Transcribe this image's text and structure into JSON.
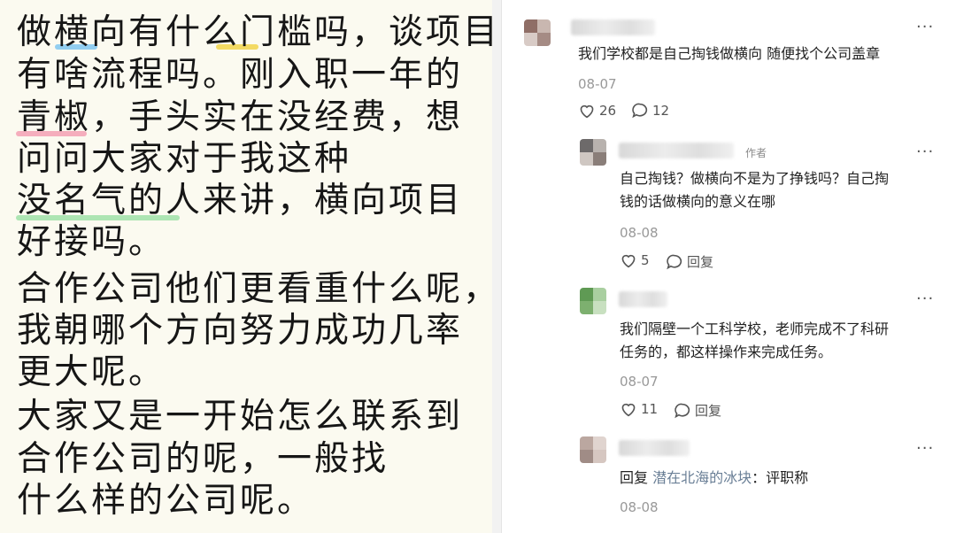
{
  "note": {
    "lines": [
      "做横向有什么门槛吗，谈项目",
      "有啥流程吗。刚入职一年的",
      "青椒，手头实在没经费，想",
      "问问大家对于我这种",
      "没名气的人来讲，横向项目",
      "好接吗。",
      "合作公司他们更看重什么呢，",
      "我朝哪个方向努力成功几率",
      "更大呢。",
      "大家又是一开始怎么联系到",
      "合作公司的呢，一般找",
      "什么样的公司呢。"
    ],
    "highlight_colors": [
      "#7fc6f0",
      "#f1d44a",
      "#f3a0b4",
      "#9fe0a8"
    ]
  },
  "comments": [
    {
      "text": "我们学校都是自己掏钱做横向 随便找个公司盖章",
      "date": "08-07",
      "likes": "26",
      "replies": "12"
    },
    {
      "author_tag": "作者",
      "text_lines": [
        "自己掏钱？做横向不是为了挣钱吗？自己掏",
        "钱的话做横向的意义在哪"
      ],
      "date": "08-08",
      "likes": "5",
      "reply_label": "回复"
    },
    {
      "text_lines": [
        "我们隔壁一个工科学校，老师完成不了科研",
        "任务的，都这样操作来完成任务。"
      ],
      "date": "08-07",
      "likes": "11",
      "reply_label": "回复"
    },
    {
      "reply_prefix": "回复",
      "reply_to": "潜在北海的冰块",
      "reply_text": "：评职称",
      "date": "08-08"
    }
  ],
  "more_label": "···"
}
